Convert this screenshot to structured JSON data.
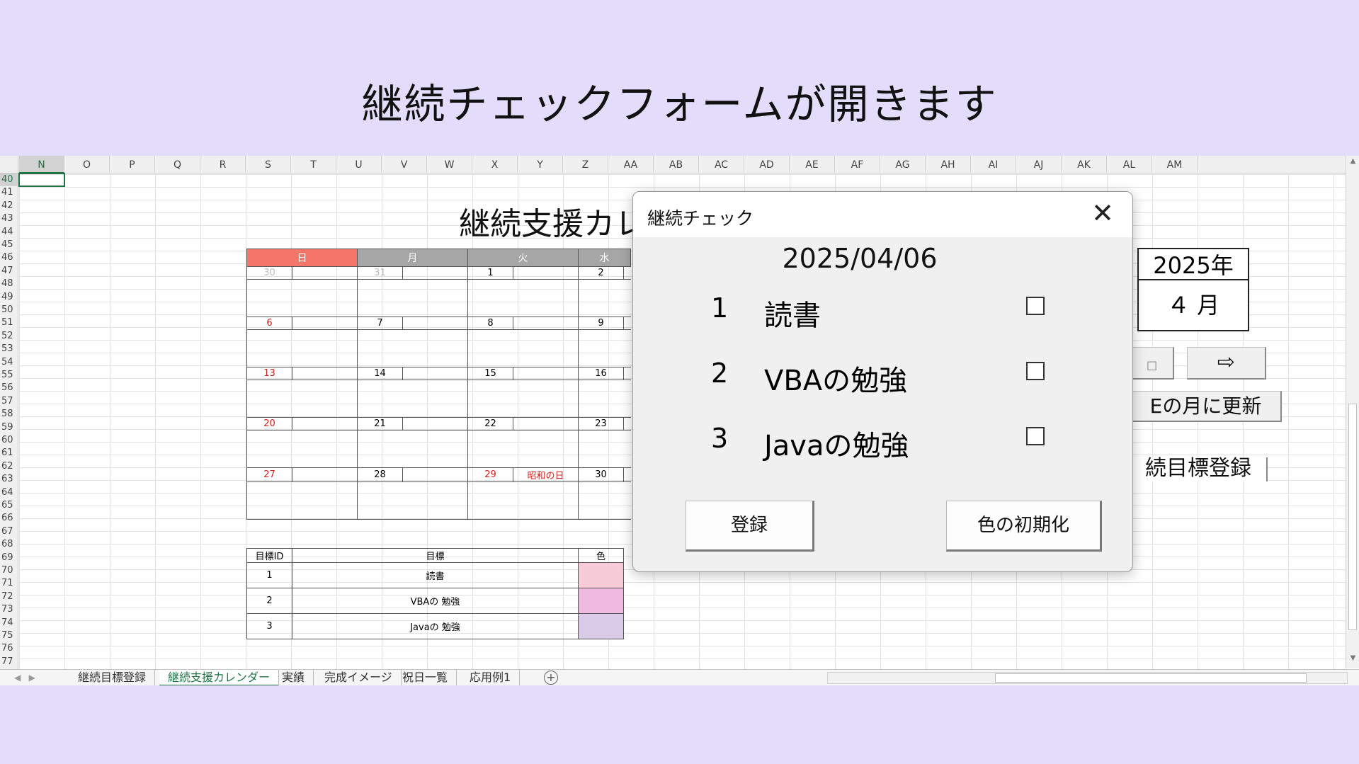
{
  "caption": "継続チェックフォームが開きます",
  "sheet": {
    "columns": [
      "N",
      "O",
      "P",
      "Q",
      "R",
      "S",
      "T",
      "U",
      "V",
      "W",
      "X",
      "Y",
      "Z",
      "AA",
      "AB",
      "AC",
      "AD",
      "AE",
      "AF",
      "AG",
      "AH",
      "AI",
      "AJ",
      "AK",
      "AL",
      "AM"
    ],
    "selected_column": "N",
    "rows": [
      "40",
      "41",
      "42",
      "43",
      "44",
      "45",
      "46",
      "47",
      "48",
      "49",
      "50",
      "51",
      "52",
      "53",
      "54",
      "55",
      "56",
      "57",
      "58",
      "59",
      "60",
      "61",
      "62",
      "63",
      "64",
      "65",
      "66",
      "67",
      "68",
      "69",
      "70",
      "71",
      "72",
      "73",
      "74",
      "75",
      "76",
      "77"
    ],
    "selected_row": "40",
    "title": "継続支援カレ",
    "weekdays": [
      "日",
      "月",
      "火",
      "水"
    ],
    "weekday_colors": [
      "#f4756a",
      "#a6a6a6",
      "#a6a6a6",
      "#a6a6a6"
    ],
    "weeks": [
      [
        {
          "d": "30",
          "s": "grey"
        },
        {
          "d": "31",
          "s": "grey"
        },
        {
          "d": "1"
        },
        {
          "d": "2"
        }
      ],
      [
        {
          "d": "6",
          "s": "red"
        },
        {
          "d": "7"
        },
        {
          "d": "8"
        },
        {
          "d": "9"
        }
      ],
      [
        {
          "d": "13",
          "s": "red"
        },
        {
          "d": "14"
        },
        {
          "d": "15"
        },
        {
          "d": "16"
        }
      ],
      [
        {
          "d": "20",
          "s": "red"
        },
        {
          "d": "21"
        },
        {
          "d": "22"
        },
        {
          "d": "23"
        }
      ],
      [
        {
          "d": "27",
          "s": "red"
        },
        {
          "d": "28"
        },
        {
          "d": "29",
          "s": "red",
          "h": "昭和の日"
        },
        {
          "d": "30"
        }
      ]
    ],
    "goals_header": [
      "目標ID",
      "目標",
      "色"
    ],
    "goals": [
      {
        "id": "1",
        "name": "読書",
        "color": "#f8cbd9"
      },
      {
        "id": "2",
        "name": "VBAの 勉強",
        "color": "#f0b9e0"
      },
      {
        "id": "3",
        "name": "Javaの 勉強",
        "color": "#d9cbe8"
      }
    ],
    "year_label": "2025年",
    "month_label": "４ 月",
    "next_arrow": "⇨",
    "prev_fragment": "□",
    "update_button": "Eの月に更新",
    "register_button": "続目標登録"
  },
  "dialog": {
    "title": "継続チェック",
    "close": "✕",
    "date": "2025/04/06",
    "items": [
      {
        "num": "1",
        "label": "読書"
      },
      {
        "num": "2",
        "label": "VBAの勉強"
      },
      {
        "num": "3",
        "label": "Javaの勉強"
      }
    ],
    "register_label": "登録",
    "reset_label": "色の初期化"
  },
  "tabs": {
    "items": [
      "継続目標登録",
      "継続支援カレンダー",
      "実績",
      "完成イメージ",
      "祝日一覧",
      "応用例1"
    ],
    "active": "継続支援カレンダー",
    "add": "+"
  }
}
